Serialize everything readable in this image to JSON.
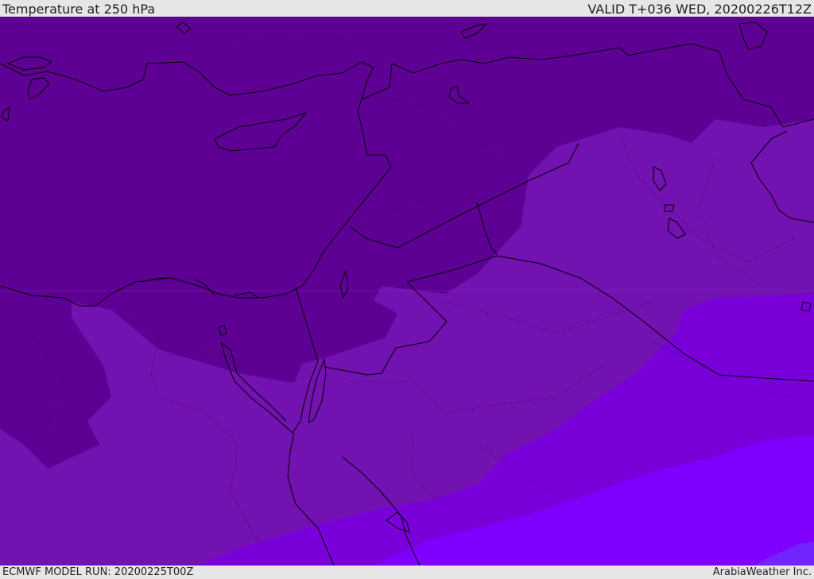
{
  "header": {
    "title": "Temperature at 250 hPa",
    "valid_time": "VALID T+036 WED, 20200226T12Z"
  },
  "footer": {
    "model_run": "ECMWF MODEL RUN: 20200225T00Z",
    "credit": "ArabiaWeather Inc."
  },
  "colors": {
    "band_coldest": "#5e0094",
    "band_2": "#7212b1",
    "band_3": "#7a00d9",
    "band_4": "#7f00ff",
    "band_warmest": "#7224ff",
    "coastline": "#000000"
  }
}
